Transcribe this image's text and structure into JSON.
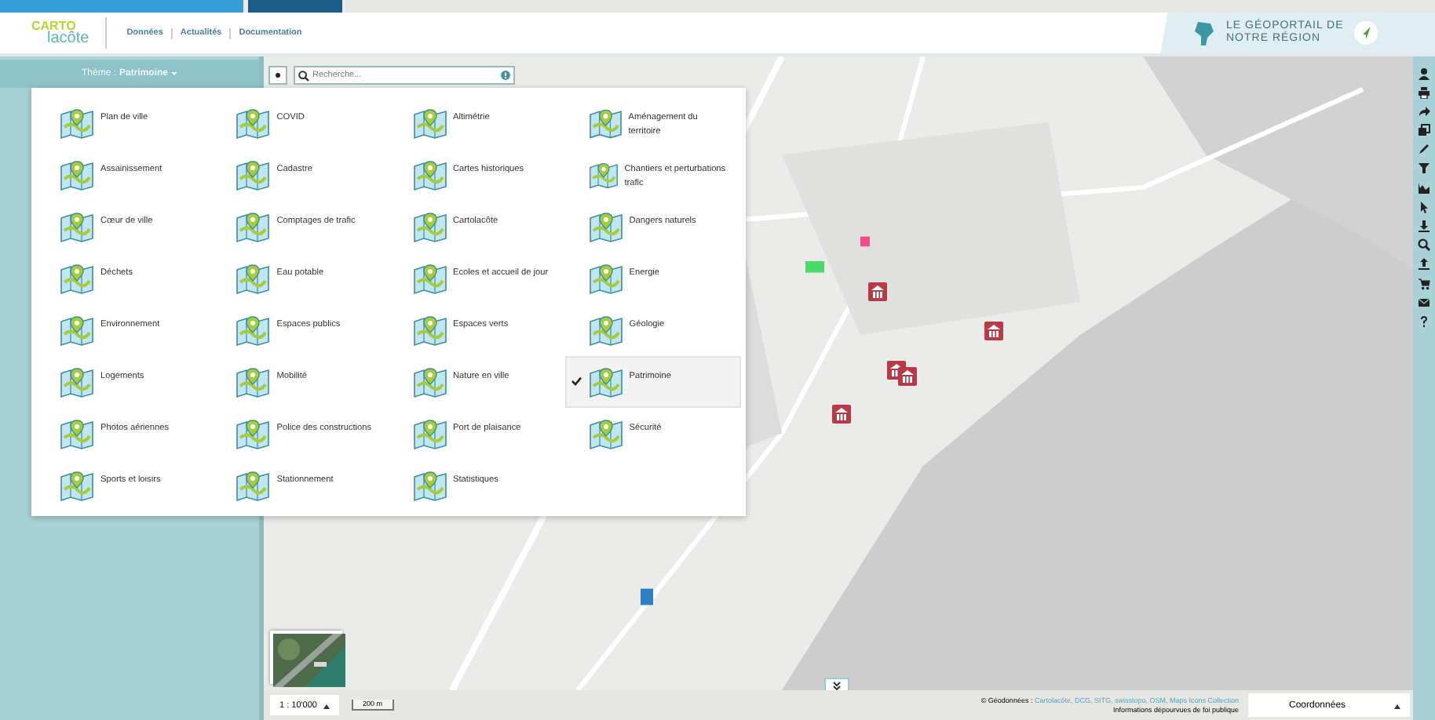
{
  "header": {
    "logo_top": "CARTO",
    "logo_bottom": "lacôte",
    "nav": [
      "Données",
      "Actualités",
      "Documentation"
    ],
    "banner": [
      "LE GÉOPORTAIL DE",
      "NOTRE RÉGION"
    ]
  },
  "theme_bar": {
    "label": "Thème :",
    "value": "Patrimoine"
  },
  "search": {
    "placeholder": "Recherche..."
  },
  "themes": [
    {
      "label": "Plan de ville",
      "selected": false
    },
    {
      "label": "COVID",
      "selected": false
    },
    {
      "label": "Altimétrie",
      "selected": false
    },
    {
      "label": "Aménagement du territoire",
      "selected": false
    },
    {
      "label": "Assainissement",
      "selected": false
    },
    {
      "label": "Cadastre",
      "selected": false
    },
    {
      "label": "Cartes historiques",
      "selected": false
    },
    {
      "label": "Chantiers et perturbations trafic",
      "selected": false
    },
    {
      "label": "Cœur de ville",
      "selected": false
    },
    {
      "label": "Comptages de trafic",
      "selected": false
    },
    {
      "label": "Cartolacôte",
      "selected": false
    },
    {
      "label": "Dangers naturels",
      "selected": false
    },
    {
      "label": "Déchets",
      "selected": false
    },
    {
      "label": "Eau potable",
      "selected": false
    },
    {
      "label": "Ecoles et accueil de jour",
      "selected": false
    },
    {
      "label": "Energie",
      "selected": false
    },
    {
      "label": "Environnement",
      "selected": false
    },
    {
      "label": "Espaces publics",
      "selected": false
    },
    {
      "label": "Espaces verts",
      "selected": false
    },
    {
      "label": "Géologie",
      "selected": false
    },
    {
      "label": "Logements",
      "selected": false
    },
    {
      "label": "Mobilité",
      "selected": false
    },
    {
      "label": "Nature en ville",
      "selected": false
    },
    {
      "label": "Patrimoine",
      "selected": true
    },
    {
      "label": "Photos aériennes",
      "selected": false
    },
    {
      "label": "Police des constructions",
      "selected": false
    },
    {
      "label": "Port de plaisance",
      "selected": false
    },
    {
      "label": "Sécurité",
      "selected": false
    },
    {
      "label": "Sports et loisirs",
      "selected": false
    },
    {
      "label": "Stationnement",
      "selected": false
    },
    {
      "label": "Statistiques",
      "selected": false
    }
  ],
  "footer": {
    "scale": "1 : 10'000",
    "scale_bar": "200 m",
    "attribution_label": "© Géodonnées :",
    "attribution_sources": "Cartolacôte, DCG, SITG, swisstopo, OSM, Maps Icons Collection",
    "disclaimer": "Informations dépourvues de foi publique",
    "coordinates": "Coordonnées"
  }
}
